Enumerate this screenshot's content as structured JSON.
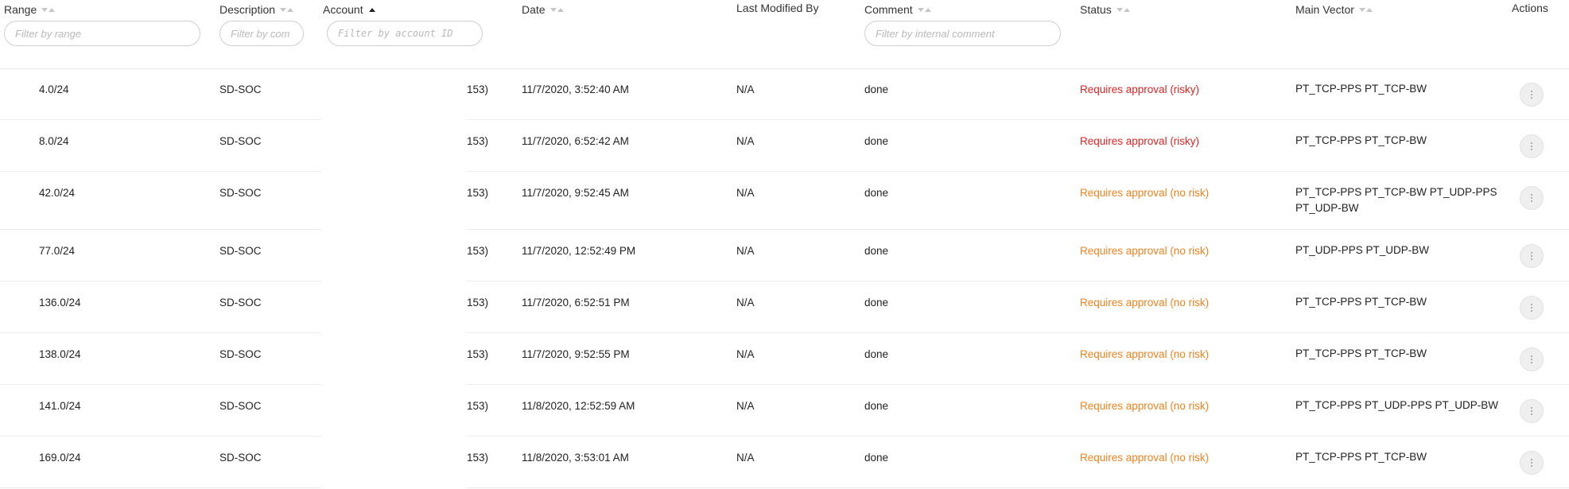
{
  "header": {
    "range": "Range",
    "description": "Description",
    "account": "Account",
    "date": "Date",
    "last_modified_by": "Last Modified By",
    "comment": "Comment",
    "status": "Status",
    "main_vector": "Main Vector",
    "actions": "Actions"
  },
  "filters": {
    "range_placeholder": "Filter by range",
    "description_placeholder": "Filter by com",
    "account_placeholder": "Filter by account ID",
    "comment_placeholder": "Filter by internal comment"
  },
  "rows": [
    {
      "range": "4.0/24",
      "description": "SD-SOC",
      "account": "153)",
      "date": "11/7/2020, 3:52:40 AM",
      "modified": "N/A",
      "comment": "done",
      "status": "Requires approval (risky)",
      "risk": "risky",
      "vector": "PT_TCP-PPS PT_TCP-BW"
    },
    {
      "range": "8.0/24",
      "description": "SD-SOC",
      "account": "153)",
      "date": "11/7/2020, 6:52:42 AM",
      "modified": "N/A",
      "comment": "done",
      "status": "Requires approval (risky)",
      "risk": "risky",
      "vector": "PT_TCP-PPS PT_TCP-BW"
    },
    {
      "range": "42.0/24",
      "description": "SD-SOC",
      "account": "153)",
      "date": "11/7/2020, 9:52:45 AM",
      "modified": "N/A",
      "comment": "done",
      "status": "Requires approval (no risk)",
      "risk": "norisk",
      "vector": "PT_TCP-PPS PT_TCP-BW PT_UDP-PPS PT_UDP-BW"
    },
    {
      "range": "77.0/24",
      "description": "SD-SOC",
      "account": "153)",
      "date": "11/7/2020, 12:52:49 PM",
      "modified": "N/A",
      "comment": "done",
      "status": "Requires approval (no risk)",
      "risk": "norisk",
      "vector": "PT_UDP-PPS PT_UDP-BW"
    },
    {
      "range": "136.0/24",
      "description": "SD-SOC",
      "account": "153)",
      "date": "11/7/2020, 6:52:51 PM",
      "modified": "N/A",
      "comment": "done",
      "status": "Requires approval (no risk)",
      "risk": "norisk",
      "vector": "PT_TCP-PPS PT_TCP-BW"
    },
    {
      "range": "138.0/24",
      "description": "SD-SOC",
      "account": "153)",
      "date": "11/7/2020, 9:52:55 PM",
      "modified": "N/A",
      "comment": "done",
      "status": "Requires approval (no risk)",
      "risk": "norisk",
      "vector": "PT_TCP-PPS PT_TCP-BW"
    },
    {
      "range": "141.0/24",
      "description": "SD-SOC",
      "account": "153)",
      "date": "11/8/2020, 12:52:59 AM",
      "modified": "N/A",
      "comment": "done",
      "status": "Requires approval (no risk)",
      "risk": "norisk",
      "vector": "PT_TCP-PPS PT_UDP-PPS PT_UDP-BW"
    },
    {
      "range": "169.0/24",
      "description": "SD-SOC",
      "account": "153)",
      "date": "11/8/2020, 3:53:01 AM",
      "modified": "N/A",
      "comment": "done",
      "status": "Requires approval (no risk)",
      "risk": "norisk",
      "vector": "PT_TCP-PPS PT_TCP-BW"
    }
  ],
  "colors": {
    "risky": "#e02424",
    "norisk": "#f0821e"
  },
  "icons": {
    "actions": "more-vertical-icon",
    "sort": "sort-icon"
  }
}
